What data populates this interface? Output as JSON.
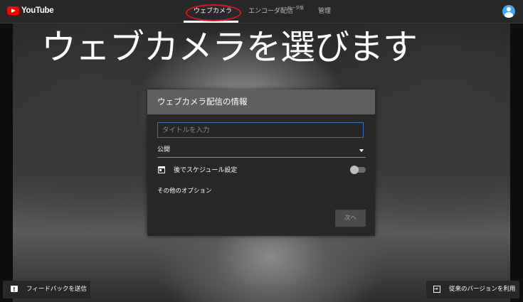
{
  "header": {
    "logo_text": "YouTube",
    "tabs": [
      {
        "label": "ウェブカメラ",
        "active": true
      },
      {
        "label": "エンコーダ配信"
      },
      {
        "label": "管理"
      }
    ],
    "beta_badge": "ベータ版"
  },
  "overlay_caption": "ウェブカメラを選びます",
  "dialog": {
    "title": "ウェブカメラ配信の情報",
    "title_input_placeholder": "タイトルを入力",
    "visibility_value": "公開",
    "schedule_label": "後でスケジュール設定",
    "schedule_toggle_on": false,
    "more_options": "その他のオプション",
    "next_button": "次へ"
  },
  "footer": {
    "feedback_button": "フィードバックを送信",
    "legacy_button": "従来のバージョンを利用"
  },
  "colors": {
    "annotation_ring": "#e0141b",
    "input_focus": "#3e6fb8",
    "brand_red": "#ff0000"
  }
}
